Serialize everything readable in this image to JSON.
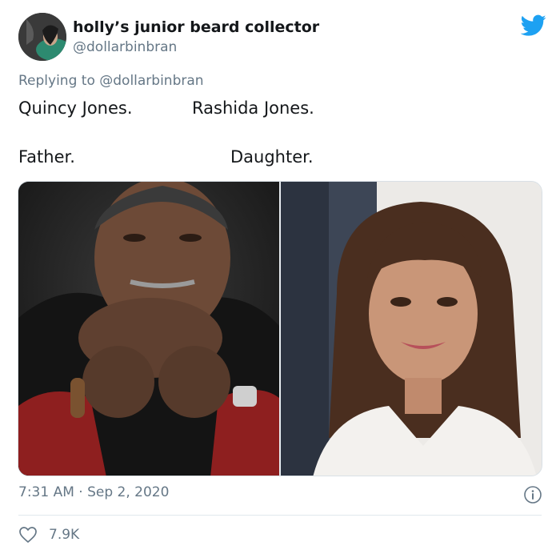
{
  "tweet": {
    "author_name": "holly’s junior beard collector",
    "author_handle": "@dollarbinbran",
    "replying_prefix": "Replying to",
    "replying_handle": "@dollarbinbran",
    "text_line1_a": "Quincy Jones.",
    "text_line1_b": "Rashida Jones.",
    "text_line2_a": "Father.",
    "text_line2_b": "Daughter.",
    "timestamp": "7:31 AM · Sep 2, 2020",
    "like_count": "7.9K"
  },
  "icons": {
    "brand": "twitter-bird-icon",
    "info": "info-icon",
    "like": "heart-icon"
  },
  "colors": {
    "twitter_blue": "#1da1f2",
    "secondary_text": "#657786",
    "primary_text": "#14171a"
  }
}
